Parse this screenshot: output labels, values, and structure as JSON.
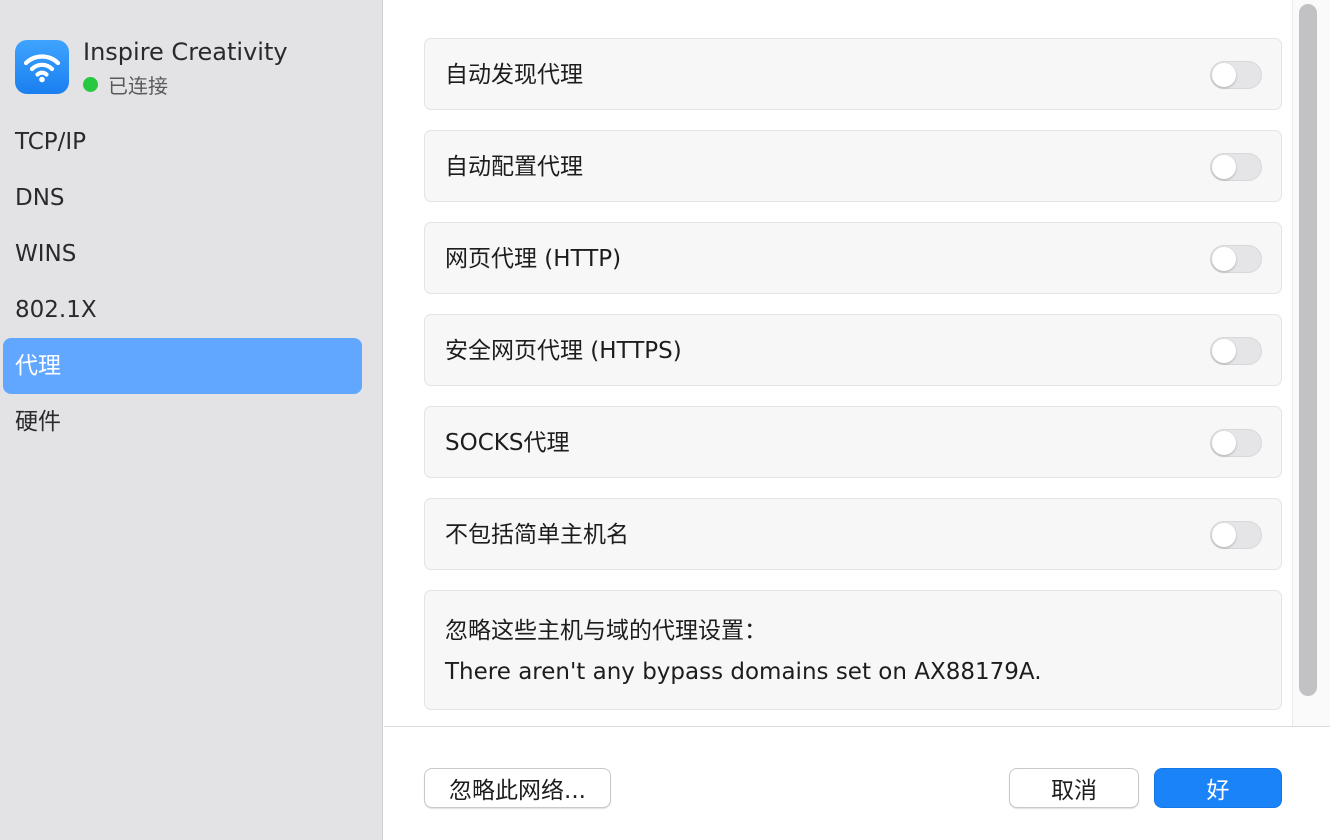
{
  "network": {
    "name": "Inspire Creativity",
    "status": "已连接",
    "icon": "wifi-icon",
    "status_color": "#28c941"
  },
  "sidebar": {
    "items": [
      {
        "label": "TCP/IP",
        "selected": false
      },
      {
        "label": "DNS",
        "selected": false
      },
      {
        "label": "WINS",
        "selected": false
      },
      {
        "label": "802.1X",
        "selected": false
      },
      {
        "label": "代理",
        "selected": true
      },
      {
        "label": "硬件",
        "selected": false
      }
    ],
    "selected_color": "#62a7ff"
  },
  "proxies": {
    "items": [
      {
        "label": "自动发现代理",
        "enabled": false
      },
      {
        "label": "自动配置代理",
        "enabled": false
      },
      {
        "label": "网页代理 (HTTP)",
        "enabled": false
      },
      {
        "label": "安全网页代理 (HTTPS)",
        "enabled": false
      },
      {
        "label": "SOCKS代理",
        "enabled": false
      },
      {
        "label": "不包括简单主机名",
        "enabled": false
      }
    ],
    "bypass": {
      "title": "忽略这些主机与域的代理设置：",
      "text": "There aren't any bypass domains set on AX88179A."
    }
  },
  "footer": {
    "ignore_network_label": "忽略此网络...",
    "cancel_label": "取消",
    "ok_label": "好",
    "accent_color": "#1a83f7"
  }
}
